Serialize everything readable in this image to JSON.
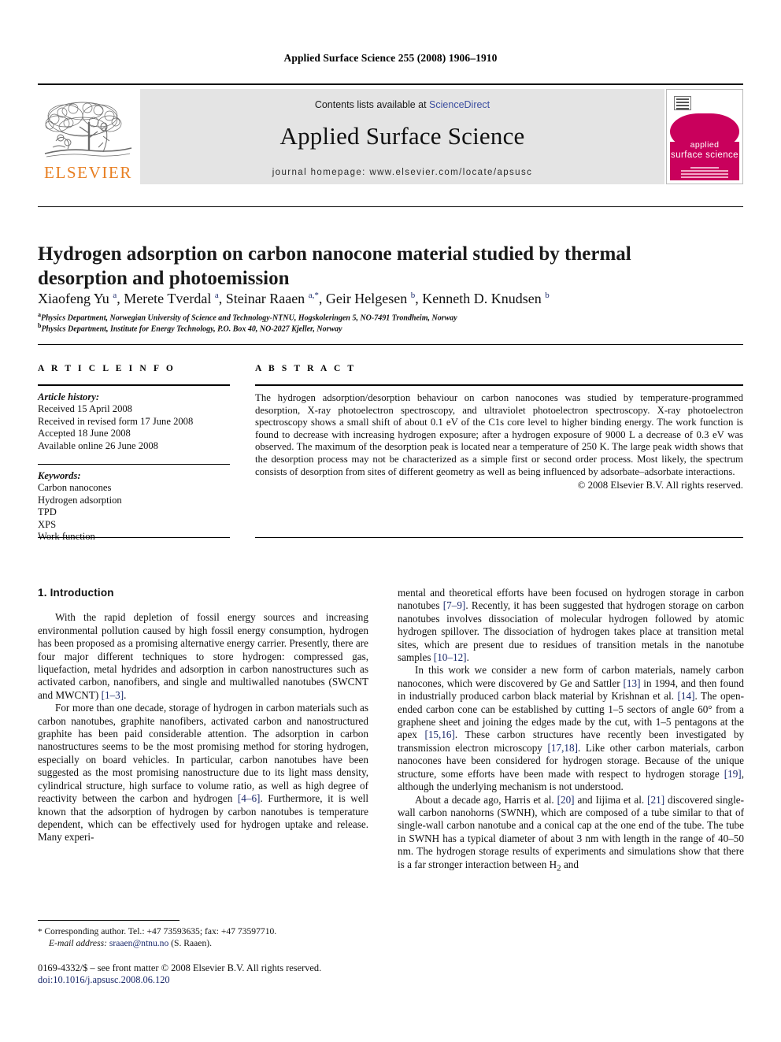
{
  "running_head": "Applied Surface Science 255 (2008) 1906–1910",
  "masthead": {
    "contents_prefix": "Contents lists available at ",
    "sciencedirect": "ScienceDirect",
    "journal_title": "Applied Surface Science",
    "homepage": "journal homepage: www.elsevier.com/locate/apsusc",
    "publisher_wordmark": "ELSEVIER",
    "cover": {
      "line1": "applied",
      "line2": "surface science"
    },
    "colors": {
      "sciencedirect_link": "#3b4ea0",
      "elsevier_orange": "#e87f22",
      "cover_magenta": "#c9005c",
      "band_gray": "#e4e4e4"
    }
  },
  "article": {
    "title": "Hydrogen adsorption on carbon nanocone material studied by thermal desorption and photoemission",
    "authors_html": "Xiaofeng Yu <sup>a</sup>, Merete Tverdal <sup>a</sup>, Steinar Raaen <sup>a,*</sup>, Geir Helgesen <sup>b</sup>, Kenneth D. Knudsen <sup>b</sup>",
    "affiliation_a": "Physics Department, Norwegian University of Science and Technology-NTNU, Hogskoleringen 5, NO-7491 Trondheim, Norway",
    "affiliation_b": "Physics Department, Institute for Energy Technology, P.O. Box 40, NO-2027 Kjeller, Norway",
    "affil_marker_a": "a",
    "affil_marker_b": "b"
  },
  "info": {
    "heading": "A R T I C L E   I N F O",
    "history_label": "Article history:",
    "history": [
      "Received 15 April 2008",
      "Received in revised form 17 June 2008",
      "Accepted 18 June 2008",
      "Available online 26 June 2008"
    ],
    "keywords_label": "Keywords:",
    "keywords": [
      "Carbon nanocones",
      "Hydrogen adsorption",
      "TPD",
      "XPS",
      "Work function"
    ]
  },
  "abstract": {
    "heading": "A B S T R A C T",
    "text": "The hydrogen adsorption/desorption behaviour on carbon nanocones was studied by temperature-programmed desorption, X-ray photoelectron spectroscopy, and ultraviolet photoelectron spectroscopy. X-ray photoelectron spectroscopy shows a small shift of about 0.1 eV of the C1s core level to higher binding energy. The work function is found to decrease with increasing hydrogen exposure; after a hydrogen exposure of 9000 L a decrease of 0.3 eV was observed. The maximum of the desorption peak is located near a temperature of 250 K. The large peak width shows that the desorption process may not be characterized as a simple first or second order process. Most likely, the spectrum consists of desorption from sites of different geometry as well as being influenced by adsorbate–adsorbate interactions.",
    "copyright": "© 2008 Elsevier B.V. All rights reserved."
  },
  "body": {
    "section_heading": "1. Introduction",
    "left_paragraphs": [
      {
        "before": "With the rapid depletion of fossil energy sources and increasing environmental pollution caused by high fossil energy consumption, hydrogen has been proposed as a promising alternative energy carrier. Presently, there are four major different techniques to store hydrogen: compressed gas, liquefaction, metal hydrides and adsorption in carbon nanostructures such as activated carbon, nanofibers, and single and multiwalled nanotubes (SWCNT and MWCNT) ",
        "ref": "[1–3]",
        "after": "."
      },
      {
        "before": "For more than one decade, storage of hydrogen in carbon materials such as carbon nanotubes, graphite nanofibers, activated carbon and nanostructured graphite has been paid considerable attention. The adsorption in carbon nanostructures seems to be the most promising method for storing hydrogen, especially on board vehicles. In particular, carbon nanotubes have been suggested as the most promising nanostructure due to its light mass density, cylindrical structure, high surface to volume ratio, as well as high degree of reactivity between the carbon and hydrogen ",
        "ref": "[4–6]",
        "after": ". Furthermore, it is well known that the adsorption of hydrogen by carbon nanotubes is temperature dependent, which can be effectively used for hydrogen uptake and release. Many experi-"
      }
    ],
    "right_paragraphs": [
      {
        "seg1": "mental and theoretical efforts have been focused on hydrogen storage in carbon nanotubes ",
        "ref1": "[7–9]",
        "seg2": ". Recently, it has been suggested that hydrogen storage on carbon nanotubes involves dissociation of molecular hydrogen followed by atomic hydrogen spillover. The dissociation of hydrogen takes place at transition metal sites, which are present due to residues of transition metals in the nanotube samples ",
        "ref2": "[10–12]",
        "seg3": "."
      },
      {
        "seg1": "In this work we consider a new form of carbon materials, namely carbon nanocones, which were discovered by Ge and Sattler ",
        "ref1": "[13]",
        "seg2": " in 1994, and then found in industrially produced carbon black material by Krishnan et al. ",
        "ref2": "[14]",
        "seg3": ". The open-ended carbon cone can be established by cutting 1–5 sectors of angle 60° from a graphene sheet and joining the edges made by the cut, with 1–5 pentagons at the apex ",
        "ref3": "[15,16]",
        "seg4": ". These carbon structures have recently been investigated by transmission electron microscopy ",
        "ref4": "[17,18]",
        "seg5": ". Like other carbon materials, carbon nanocones have been considered for hydrogen storage. Because of the unique structure, some efforts have been made with respect to hydrogen storage ",
        "ref5": "[19]",
        "seg6": ", although the underlying mechanism is not understood."
      },
      {
        "seg1": "About a decade ago, Harris et al. ",
        "ref1": "[20]",
        "seg2": " and Iijima et al. ",
        "ref2": "[21]",
        "seg3": " discovered single-wall carbon nanohorns (SWNH), which are composed of a tube similar to that of single-wall carbon nanotube and a conical cap at the one end of the tube. The tube in SWNH has a typical diameter of about 3 nm with length in the range of 40–50 nm. The hydrogen storage results of experiments and simulations show that there is a far stronger interaction between H",
        "sub": "2",
        "seg4": " and"
      }
    ]
  },
  "footnote": {
    "marker": "*",
    "corresponding": "Corresponding author. Tel.: +47 73593635; fax: +47 73597710.",
    "email_label": "E-mail address:",
    "email": "sraaen@ntnu.no",
    "email_suffix": "(S. Raaen)."
  },
  "footer": {
    "copyright": "0169-4332/$ – see front matter © 2008 Elsevier B.V. All rights reserved.",
    "doi": "doi:10.1016/j.apsusc.2008.06.120"
  }
}
